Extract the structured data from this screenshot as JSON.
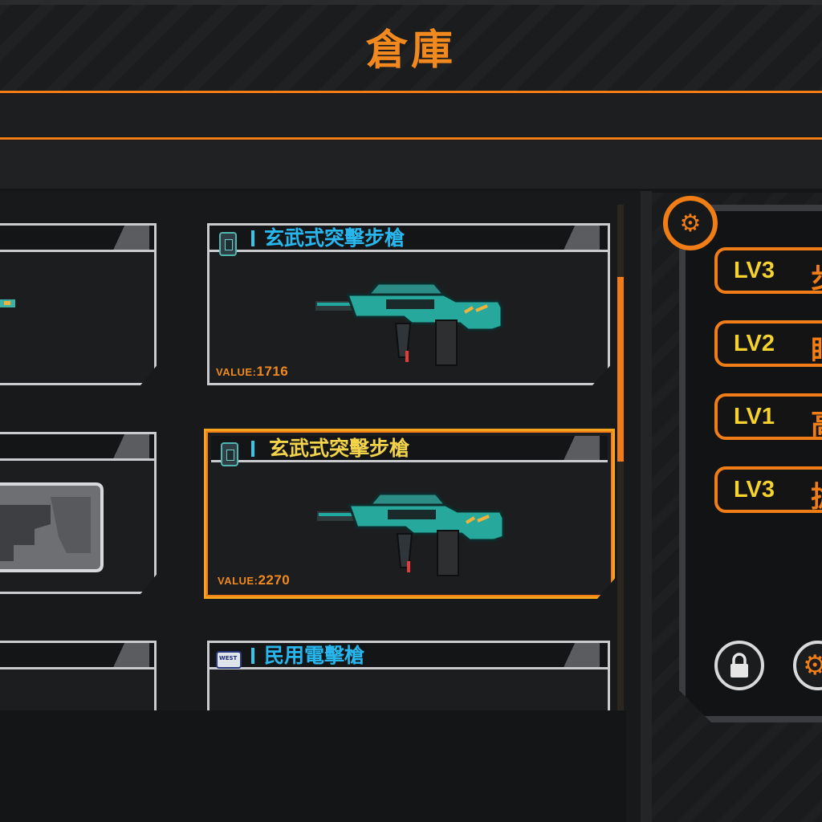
{
  "header": {
    "title": "倉庫"
  },
  "items": [
    {
      "name": "玄武式突擊步槍",
      "value_label": "VALUE:",
      "value": "1716",
      "selected": false
    },
    {
      "name": "玄武式突擊步槍",
      "value_label": "VALUE:",
      "value": "2270",
      "selected": true
    },
    {
      "name": "民用電擊槍",
      "badge_text": "WEST",
      "selected": false
    }
  ],
  "detail": {
    "skills": [
      {
        "level": "LV3",
        "name": "步"
      },
      {
        "level": "LV2",
        "name": "眼"
      },
      {
        "level": "LV1",
        "name": "高"
      },
      {
        "level": "LV3",
        "name": "搶"
      }
    ]
  },
  "colors": {
    "accent": "#f07d16",
    "item_name": "#27b7ee",
    "selected_name": "#f2d34a",
    "level": "#f5d22e"
  },
  "icons": {
    "detail_badge": "gear-icon",
    "lock_button": "lock-icon",
    "settings_button": "gear-icon"
  }
}
